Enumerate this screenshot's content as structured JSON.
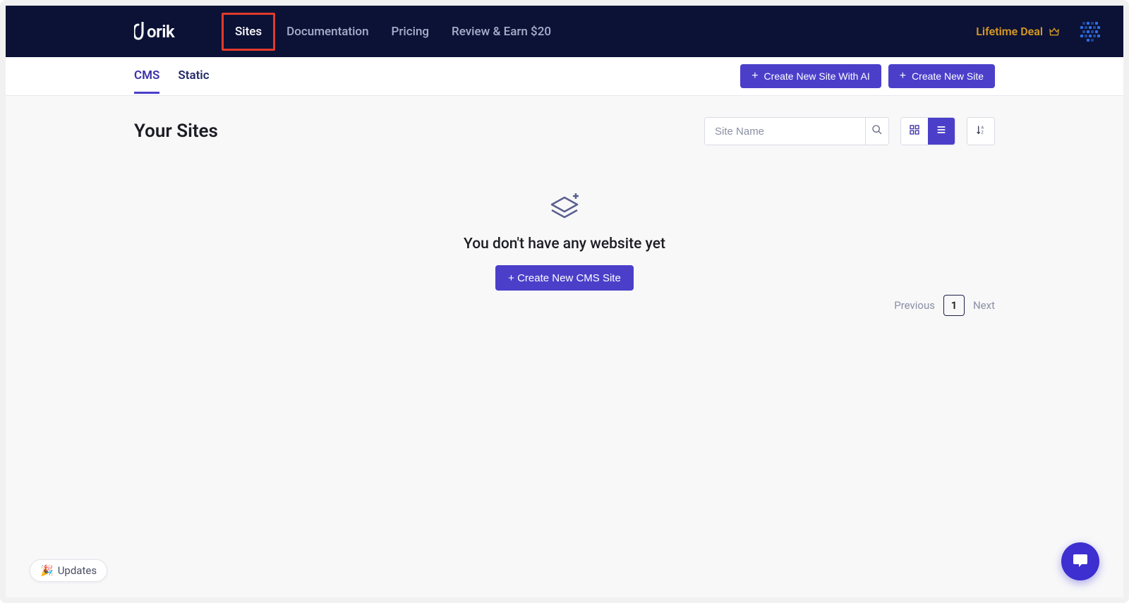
{
  "header": {
    "brand": "dorik",
    "nav": {
      "sites": "Sites",
      "documentation": "Documentation",
      "pricing": "Pricing",
      "review": "Review & Earn $20"
    },
    "lifetime_deal": "Lifetime Deal"
  },
  "subbar": {
    "tabs": {
      "cms": "CMS",
      "static": "Static"
    },
    "create_with_ai": "Create New Site With AI",
    "create_new_site": "Create New Site"
  },
  "main": {
    "title": "Your Sites",
    "search_placeholder": "Site Name",
    "empty_message": "You don't have any website yet",
    "create_cms": "+ Create New CMS Site"
  },
  "pagination": {
    "prev": "Previous",
    "page": "1",
    "next": "Next"
  },
  "footer": {
    "updates": "Updates"
  }
}
